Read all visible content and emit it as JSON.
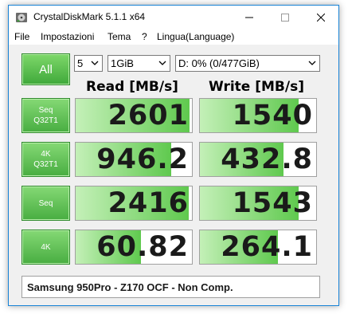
{
  "window": {
    "title": "CrystalDiskMark 5.1.1 x64"
  },
  "menu": {
    "items": [
      "File",
      "Impostazioni",
      "Tema",
      "?",
      "Lingua(Language)"
    ]
  },
  "controls": {
    "all_label": "All",
    "count_value": "5",
    "size_value": "1GiB",
    "drive_value": "D: 0% (0/477GiB)"
  },
  "headers": {
    "read": "Read [MB/s]",
    "write": "Write [MB/s]"
  },
  "tests": [
    {
      "line1": "Seq",
      "line2": "Q32T1",
      "read": "2601",
      "write": "1540",
      "read_fill": 0.98,
      "write_fill": 0.85
    },
    {
      "line1": "4K",
      "line2": "Q32T1",
      "read": "946.2",
      "write": "432.8",
      "read_fill": 0.82,
      "write_fill": 0.72
    },
    {
      "line1": "Seq",
      "line2": "",
      "read": "2416",
      "write": "1543",
      "read_fill": 0.97,
      "write_fill": 0.85
    },
    {
      "line1": "4K",
      "line2": "",
      "read": "60.82",
      "write": "264.1",
      "read_fill": 0.56,
      "write_fill": 0.67
    }
  ],
  "comment": "Samsung 950Pro - Z170 OCF - Non Comp.",
  "colors": {
    "accent_green": "#48ad41",
    "bar_green": "#5fc94e",
    "window_border": "#1883d7"
  },
  "icons": {
    "app": "crystaldiskmark-disk-icon",
    "minimize": "minimize-icon",
    "maximize": "maximize-icon",
    "close": "close-icon",
    "dropdown": "chevron-down-icon"
  }
}
